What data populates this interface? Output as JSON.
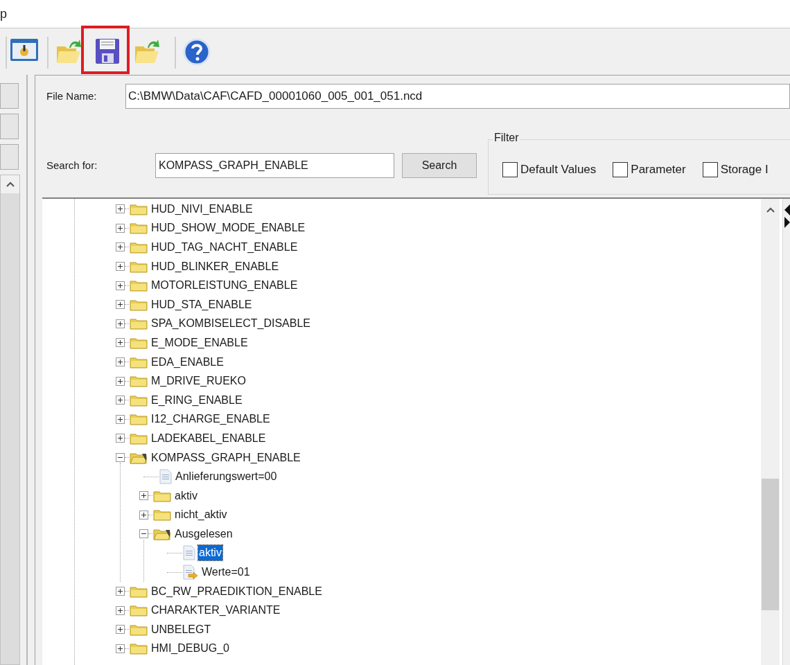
{
  "window": {
    "title": "p"
  },
  "toolbar": [
    {
      "highlighted": false
    },
    {
      "highlighted": false
    },
    {
      "highlighted": true
    },
    {
      "highlighted": false
    },
    {
      "highlighted": false
    }
  ],
  "file_name": {
    "label": "File Name:",
    "value": "C:\\BMW\\Data\\CAF\\CAFD_00001060_005_001_051.ncd"
  },
  "search": {
    "label": "Search for:",
    "value": "KOMPASS_GRAPH_ENABLE",
    "button": "Search"
  },
  "filter": {
    "title": "Filter",
    "options": [
      {
        "label": "Default Values",
        "checked": false
      },
      {
        "label": "Parameter",
        "checked": false
      },
      {
        "label": "Storage I",
        "checked": false
      }
    ]
  },
  "tree": [
    {
      "label": "HUD_NIVI_ENABLE",
      "kind": "folder",
      "expanded": false,
      "selected": false
    },
    {
      "label": "HUD_SHOW_MODE_ENABLE",
      "kind": "folder",
      "expanded": false,
      "selected": false
    },
    {
      "label": "HUD_TAG_NACHT_ENABLE",
      "kind": "folder",
      "expanded": false,
      "selected": false
    },
    {
      "label": "HUD_BLINKER_ENABLE",
      "kind": "folder",
      "expanded": false,
      "selected": false
    },
    {
      "label": "MOTORLEISTUNG_ENABLE",
      "kind": "folder",
      "expanded": false,
      "selected": false
    },
    {
      "label": "HUD_STA_ENABLE",
      "kind": "folder",
      "expanded": false,
      "selected": false
    },
    {
      "label": "SPA_KOMBISELECT_DISABLE",
      "kind": "folder",
      "expanded": false,
      "selected": false
    },
    {
      "label": "E_MODE_ENABLE",
      "kind": "folder",
      "expanded": false,
      "selected": false
    },
    {
      "label": "EDA_ENABLE",
      "kind": "folder",
      "expanded": false,
      "selected": false
    },
    {
      "label": "M_DRIVE_RUEKO",
      "kind": "folder",
      "expanded": false,
      "selected": false
    },
    {
      "label": "E_RING_ENABLE",
      "kind": "folder",
      "expanded": false,
      "selected": false
    },
    {
      "label": "I12_CHARGE_ENABLE",
      "kind": "folder",
      "expanded": false,
      "selected": false
    },
    {
      "label": "LADEKABEL_ENABLE",
      "kind": "folder",
      "expanded": false,
      "selected": false
    },
    {
      "label": "KOMPASS_GRAPH_ENABLE",
      "kind": "folder",
      "expanded": true,
      "selected": false,
      "children": [
        {
          "label": "Anlieferungswert=00",
          "kind": "document",
          "selected": false
        },
        {
          "label": "aktiv",
          "kind": "folder",
          "expanded": false,
          "selected": false
        },
        {
          "label": "nicht_aktiv",
          "kind": "folder",
          "expanded": false,
          "selected": false
        },
        {
          "label": "Ausgelesen",
          "kind": "folder",
          "expanded": true,
          "selected": false,
          "children": [
            {
              "label": "aktiv",
              "kind": "document",
              "selected": true
            },
            {
              "label": "Werte=01",
              "kind": "value",
              "selected": false
            }
          ]
        }
      ]
    },
    {
      "label": "BC_RW_PRAEDIKTION_ENABLE",
      "kind": "folder",
      "expanded": false,
      "selected": false
    },
    {
      "label": "CHARAKTER_VARIANTE",
      "kind": "folder",
      "expanded": false,
      "selected": false
    },
    {
      "label": "UNBELEGT",
      "kind": "folder",
      "expanded": false,
      "selected": false
    },
    {
      "label": "HMI_DEBUG_0",
      "kind": "folder",
      "expanded": false,
      "selected": false
    }
  ]
}
